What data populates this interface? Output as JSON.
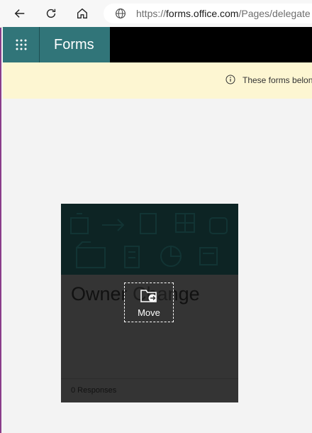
{
  "browser": {
    "url_prefix": "https://",
    "url_host": "forms.office.com",
    "url_path": "/Pages/delegate"
  },
  "app": {
    "brand": "Forms"
  },
  "banner": {
    "text": "These forms belon"
  },
  "card": {
    "title": "Owner Change",
    "responses": "0 Responses",
    "move_label": "Move"
  },
  "colors": {
    "brand_teal": "#317579",
    "banner_bg": "#fdf6d2",
    "card_bg": "#343434"
  }
}
